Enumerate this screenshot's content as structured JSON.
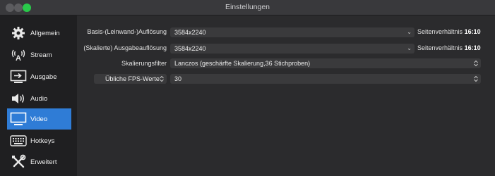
{
  "window": {
    "title": "Einstellungen"
  },
  "sidebar": {
    "items": [
      {
        "label": "Allgemein",
        "icon": "gear-icon"
      },
      {
        "label": "Stream",
        "icon": "antenna-icon"
      },
      {
        "label": "Ausgabe",
        "icon": "output-icon"
      },
      {
        "label": "Audio",
        "icon": "speaker-icon"
      },
      {
        "label": "Video",
        "icon": "monitor-icon",
        "active": true
      },
      {
        "label": "Hotkeys",
        "icon": "keyboard-icon"
      },
      {
        "label": "Erweitert",
        "icon": "tools-icon"
      }
    ]
  },
  "video": {
    "base_resolution": {
      "label": "Basis-(Leinwand-)Auflösung",
      "value": "3584x2240",
      "aspect_prefix": "Seitenverhältnis",
      "aspect_value": "16:10"
    },
    "output_resolution": {
      "label": "(Skalierte) Ausgabeauflösung",
      "value": "3584x2240",
      "aspect_prefix": "Seitenverhältnis",
      "aspect_value": "16:10"
    },
    "scale_filter": {
      "label": "Skalierungsfilter",
      "value": "Lanczos (geschärfte Skalierung,36 Stichproben)"
    },
    "fps": {
      "type_label": "Übliche FPS-Werte",
      "value": "30"
    }
  },
  "colors": {
    "accent": "#2f7cd6",
    "sidebar_bg": "#1f1f21",
    "main_bg": "#2b2b2d",
    "field_bg": "#3a3a3c"
  }
}
